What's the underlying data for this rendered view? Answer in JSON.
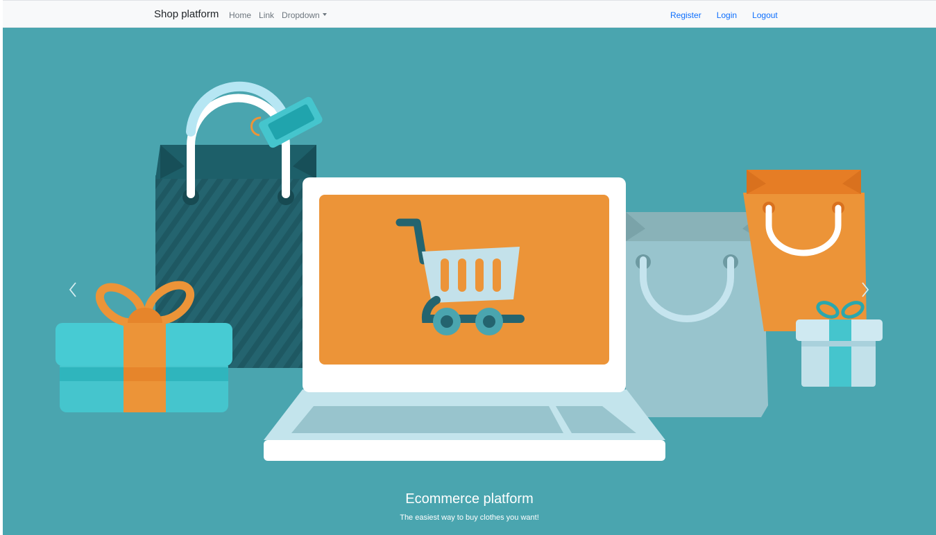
{
  "navbar": {
    "brand": "Shop platform",
    "links": [
      "Home",
      "Link"
    ],
    "dropdown": "Dropdown",
    "auth": {
      "register": "Register",
      "login": "Login",
      "logout": "Logout"
    }
  },
  "carousel": {
    "title": "Ecommerce platform",
    "subtitle": "The easiest way to buy clothes you want!",
    "prev_icon": "chevron-left-icon",
    "next_icon": "chevron-right-icon"
  },
  "colors": {
    "navbar_bg": "#f8f9fa",
    "link_primary": "#0d6efd",
    "hero_bg": "#4aa5af",
    "accent_orange": "#ec9438"
  }
}
